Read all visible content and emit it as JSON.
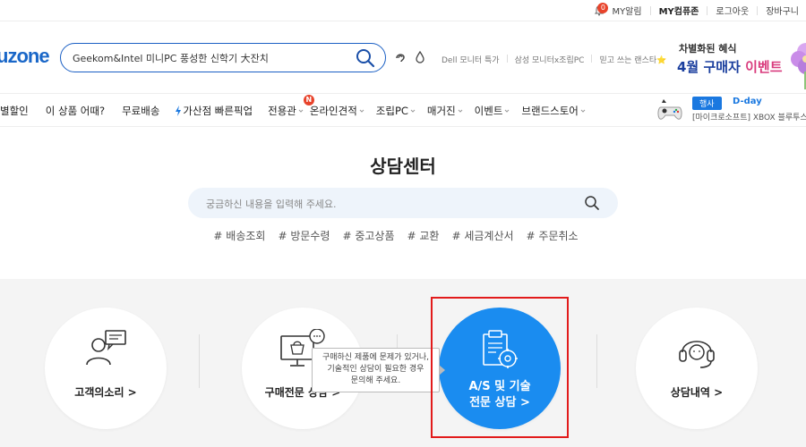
{
  "topbar": {
    "alarm_count": "0",
    "alarm_label": "MY알림",
    "myzone": "MY컴퓨존",
    "logout": "로그아웃",
    "cart": "장바구니"
  },
  "header": {
    "logo": "uzone",
    "search_value": "Geekom&Intel 미니PC 풍성한 신학기 大잔치",
    "links": [
      "Dell 모니터 특가",
      "삼성 모니터x조립PC",
      "믿고 쓰는 랜스타⭐"
    ],
    "ad_line1": "차별화된 혜식",
    "ad_line2a": "4월 구매자 ",
    "ad_line2b": "이벤트"
  },
  "nav": {
    "items": [
      "별할인",
      "이 상품 어때?",
      "무료배송",
      "가산점 빠른픽업",
      "전용관",
      "온라인견적",
      "조립PC",
      "매거진",
      "이벤트",
      "브랜드스토어"
    ],
    "new_badge": "N",
    "event_badge": "행사",
    "event_dday": "D-day",
    "event_desc": "[마이크로소프트] XBOX 블루투스"
  },
  "center": {
    "title": "상담센터",
    "search_placeholder": "궁금하신 내용을 입력해 주세요.",
    "tags": [
      "# 배송조회",
      "# 방문수령",
      "# 중고상품",
      "# 교환",
      "# 세금계산서",
      "# 주문취소"
    ]
  },
  "services": {
    "voice": "고객의소리 >",
    "purchase": "구매전문 상담 >",
    "as_line1": "A/S 및 기술",
    "as_line2": "전문 상담 >",
    "history": "상담내역 >"
  },
  "tooltip": {
    "line1": "구매하신 제품에 문제가 있거나,",
    "line2": "기술적인 상담이 필요한 경우",
    "line3": "문의해 주세요."
  },
  "colors": {
    "accent": "#1a8cf0",
    "brand": "#1a67c8",
    "highlight": "#e21b1b"
  }
}
